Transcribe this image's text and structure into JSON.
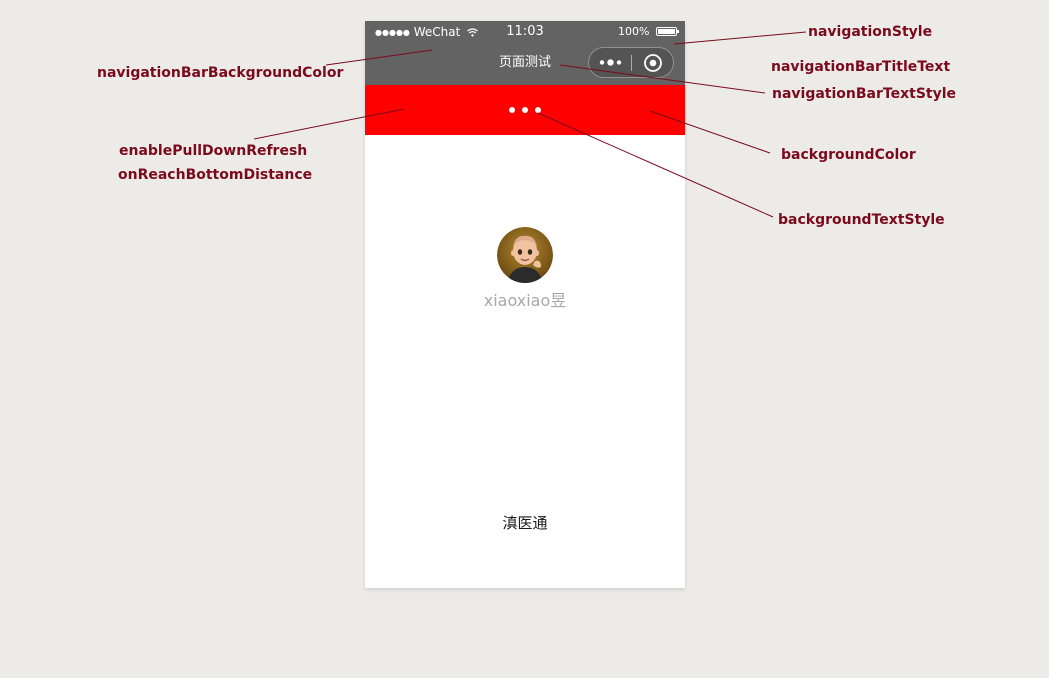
{
  "phone": {
    "status_bar": {
      "carrier": "WeChat",
      "signal_dots": "●●●●●",
      "time": "11:03",
      "battery": "100%"
    },
    "navigation_bar": {
      "title": "页面测试",
      "background_color": "#636363",
      "text_color": "#ffffff"
    },
    "pull_down_area": {
      "background_color": "#ff0000",
      "loading_dots_color": "#ffffff"
    },
    "profile": {
      "nickname": "xiaoxiao昱",
      "avatar_icon": "cartoon-avatar"
    },
    "footer_text": "滇医通"
  },
  "annotations": {
    "navigationStyle": "navigationStyle",
    "navigationBarBackgroundColor": "navigationBarBackgroundColor",
    "navigationBarTitleText": "navigationBarTitleText",
    "navigationBarTextStyle": "navigationBarTextStyle",
    "enablePullDownRefresh": "enablePullDownRefresh",
    "onReachBottomDistance": "onReachBottomDistance",
    "backgroundColor": "backgroundColor",
    "backgroundTextStyle": "backgroundTextStyle",
    "color": "#7a0a1c"
  }
}
